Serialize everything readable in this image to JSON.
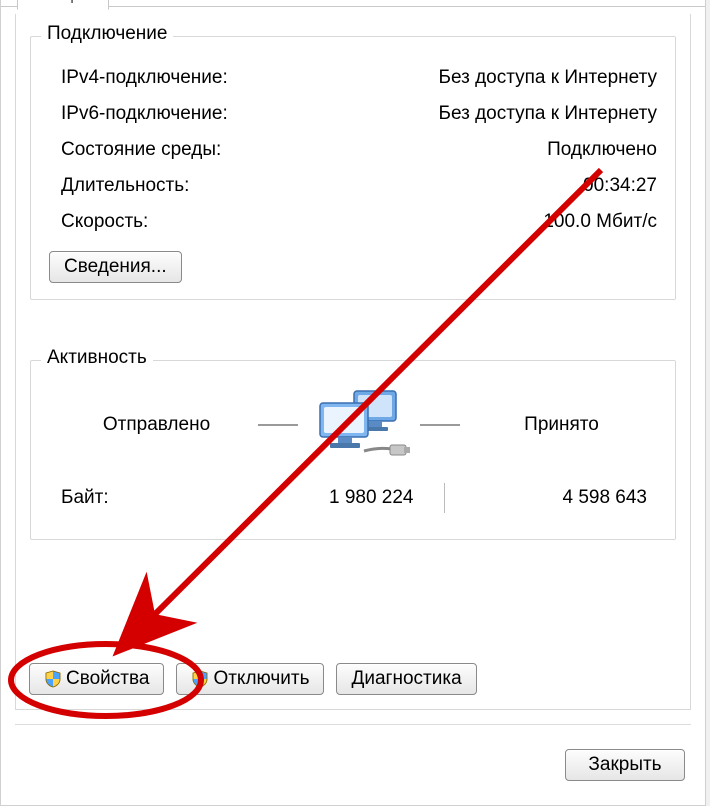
{
  "tab": {
    "active_label": "Общие"
  },
  "connection": {
    "title": "Подключение",
    "rows": {
      "ipv4_label": "IPv4-подключение:",
      "ipv4_value": "Без доступа к Интернету",
      "ipv6_label": "IPv6-подключение:",
      "ipv6_value": "Без доступа к Интернету",
      "media_label": "Состояние среды:",
      "media_value": "Подключено",
      "duration_label": "Длительность:",
      "duration_value": "00:34:27",
      "speed_label": "Скорость:",
      "speed_value": "100.0 Мбит/с"
    },
    "details_button": "Сведения..."
  },
  "activity": {
    "title": "Активность",
    "sent_label": "Отправлено",
    "received_label": "Принято",
    "bytes_label": "Байт:",
    "sent_bytes": "1 980 224",
    "received_bytes": "4 598 643"
  },
  "buttons": {
    "properties": "Свойства",
    "disable": "Отключить",
    "diagnose": "Диагностика",
    "close": "Закрыть"
  },
  "icons": {
    "shield": "shield-icon",
    "network": "network-computers-icon"
  },
  "annotation": {
    "highlight_target": "properties-button",
    "color": "#d40000"
  }
}
